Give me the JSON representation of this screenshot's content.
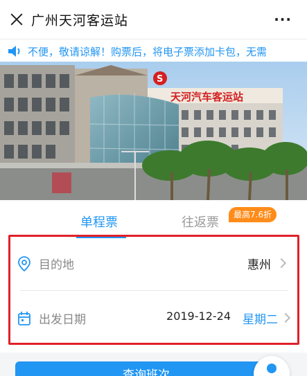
{
  "header": {
    "title": "广州天河客运站",
    "more_label": "···"
  },
  "notice": {
    "text": "不便，敬请谅解！购票后，将电子票添加卡包，无需"
  },
  "banner": {
    "sign_text": "天河汽车客运站"
  },
  "tabs": {
    "oneway_label": "单程票",
    "return_label": "往返票",
    "badge": "最高7.6折"
  },
  "form": {
    "destination_label": "目的地",
    "destination_value": "惠州",
    "date_label": "出发日期",
    "date_value": "2019-12-24",
    "weekday_value": "星期二"
  },
  "actions": {
    "query_label": "查询班次"
  },
  "colors": {
    "accent": "#2196f3",
    "badge": "#ff8c1a",
    "highlight": "#e0202a"
  }
}
